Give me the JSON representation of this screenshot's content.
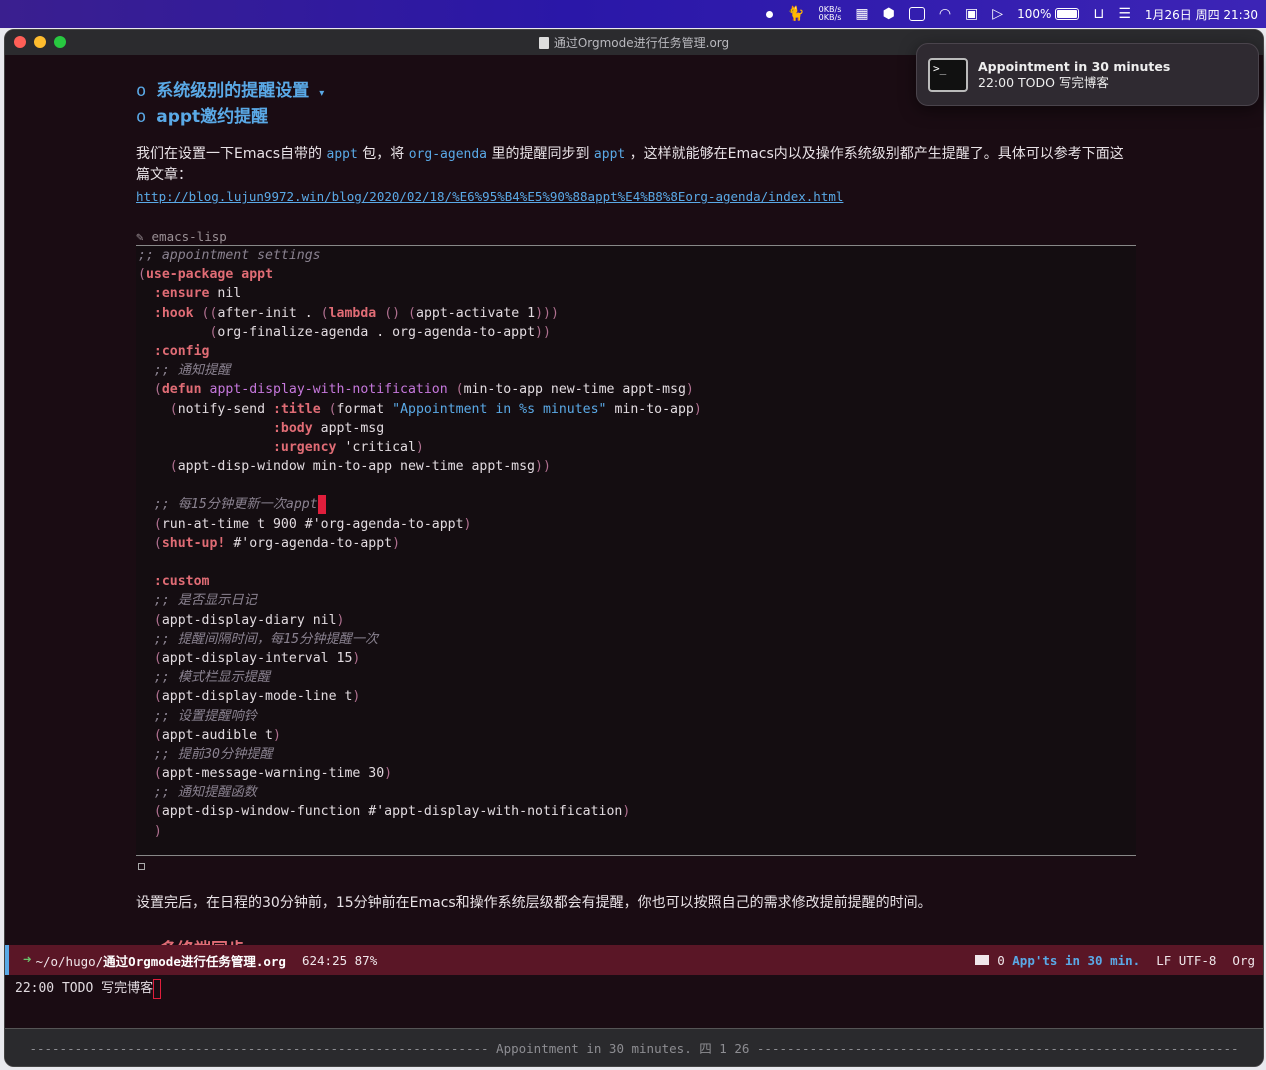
{
  "menubar": {
    "net_up": "0KB/s",
    "net_down": "0KB/s",
    "battery": "100%",
    "datetime": "1月26日 周四  21:30"
  },
  "window": {
    "title": "通过Orgmode进行任务管理.org"
  },
  "notification": {
    "title": "Appointment in 30 minutes",
    "body": "22:00 TODO 写完博客",
    "icon": "terminal-icon",
    "icon_glyph": ">_"
  },
  "doc": {
    "heading1": "系统级别的提醒设置",
    "heading2": "appt邀约提醒",
    "bullet": "o",
    "para1": {
      "t1": "我们在设置一下Emacs自带的 ",
      "c1": "appt",
      "t2": " 包，将 ",
      "c2": "org-agenda",
      "t3": " 里的提醒同步到 ",
      "c3": "appt",
      "t4": " ，这样就能够在Emacs内以及操作系统级别都产生提醒了。具体可以参考下面这篇文章："
    },
    "link": "http://blog.lujun9972.win/blog/2020/02/18/%E6%95%B4%E5%90%88appt%E4%B8%8Eorg-agenda/index.html",
    "src_lang": "emacs-lisp",
    "para2": "设置完后，在日程的30分钟前，15分钟前在Emacs和操作系统层级都会有提醒，你也可以按照自己的需求修改提前提醒的时间。",
    "next_heading": "多终端同步"
  },
  "modeline": {
    "path_prefix": "~/o/hugo/",
    "path_file": "通过Orgmode进行任务管理.org",
    "position": "624:25 87%",
    "appt_count": "0",
    "appt_text": "App'ts in 30 min.",
    "encoding": "LF UTF-8",
    "mode": "Org"
  },
  "echo_area": "22:00 TODO 写完博客",
  "minibuffer": "Appointment in 30 minutes. 四  1 26"
}
